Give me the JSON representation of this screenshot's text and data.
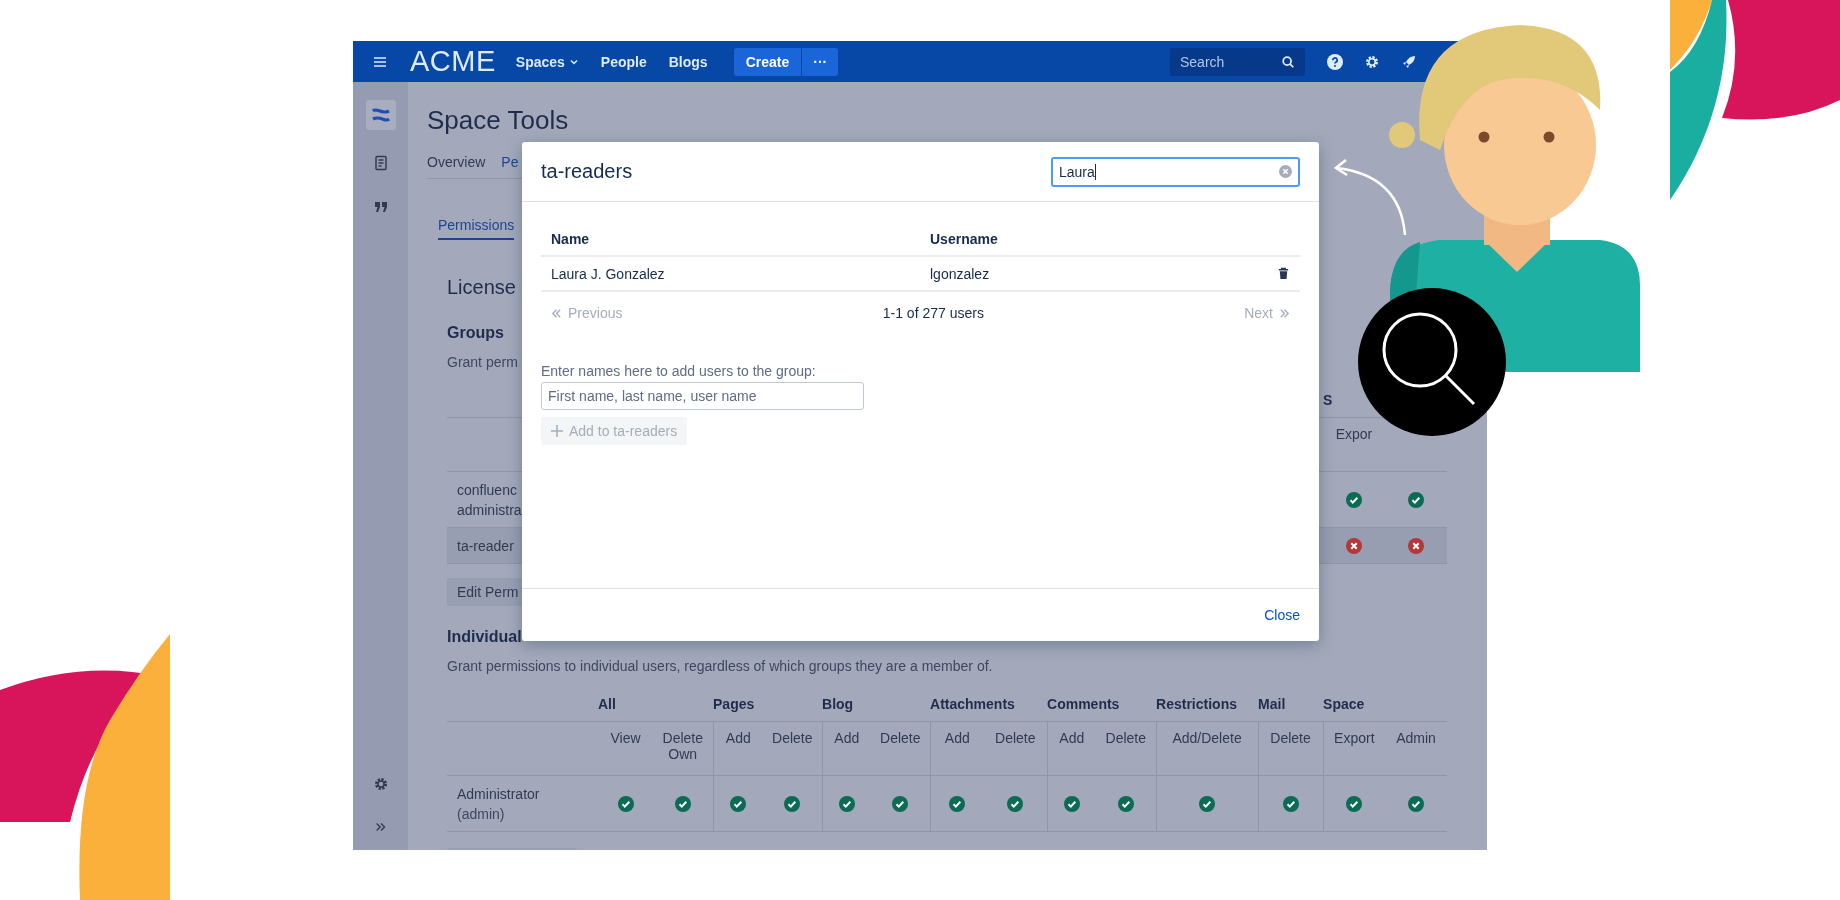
{
  "top_bar": {
    "logo": "ACME",
    "nav": [
      {
        "label": "Spaces",
        "dropdown": true
      },
      {
        "label": "People",
        "dropdown": false
      },
      {
        "label": "Blogs",
        "dropdown": false
      }
    ],
    "create_button": "Create",
    "more_button": "···",
    "search": {
      "placeholder": "Search"
    }
  },
  "page": {
    "title": "Space Tools",
    "tabs": [
      {
        "label": "Overview",
        "selected": false
      },
      {
        "label": "Pe",
        "selected": true
      }
    ],
    "subtabs": [
      {
        "label": "Permissions",
        "selected": true
      }
    ],
    "section_heading": "License",
    "groups": {
      "heading": "Groups",
      "description": "Grant perm",
      "group_header": "S",
      "subheader": "Expor",
      "rows": [
        {
          "name_lines": [
            "confluenc",
            "administra"
          ],
          "highlighted": false,
          "permissions": [
            true,
            true
          ]
        },
        {
          "name_lines": [
            "ta-reader"
          ],
          "highlighted": true,
          "permissions": [
            false,
            false
          ]
        }
      ],
      "edit_button": "Edit Perm"
    },
    "individual": {
      "heading": "Individual",
      "description": "Grant permissions to individual users, regardless of which groups they are a member of.",
      "categories": [
        {
          "label": "All",
          "columns": [
            "View",
            "Delete Own"
          ]
        },
        {
          "label": "Pages",
          "columns": [
            "Add",
            "Delete"
          ]
        },
        {
          "label": "Blog",
          "columns": [
            "Add",
            "Delete"
          ]
        },
        {
          "label": "Attachments",
          "columns": [
            "Add",
            "Delete"
          ]
        },
        {
          "label": "Comments",
          "columns": [
            "Add",
            "Delete"
          ]
        },
        {
          "label": "Restrictions",
          "columns": [
            "Add/Delete"
          ]
        },
        {
          "label": "Mail",
          "columns": [
            "Delete"
          ]
        },
        {
          "label": "Space",
          "columns": [
            "Export",
            "Admin"
          ]
        }
      ],
      "rows": [
        {
          "name": "Administrator",
          "username": "(admin)",
          "permissions": [
            true,
            true,
            true,
            true,
            true,
            true,
            true,
            true,
            true,
            true,
            true,
            true,
            true,
            true
          ]
        }
      ]
    }
  },
  "dialog": {
    "title": "ta-readers",
    "search": {
      "value": "Laura"
    },
    "columns": [
      "Name",
      "Username"
    ],
    "rows": [
      {
        "name": "Laura J. Gonzalez",
        "username": "lgonzalez"
      }
    ],
    "pagination": {
      "previous": {
        "label": "Previous",
        "disabled": true
      },
      "summary": "1-1 of 277 users",
      "next": {
        "label": "Next",
        "disabled": true
      }
    },
    "add_label": "Enter names here to add users to the group:",
    "add_field": {
      "placeholder": "First name, last name, user name"
    },
    "add_button": {
      "label": "Add to ta-readers",
      "disabled": true
    },
    "close": "Close"
  }
}
